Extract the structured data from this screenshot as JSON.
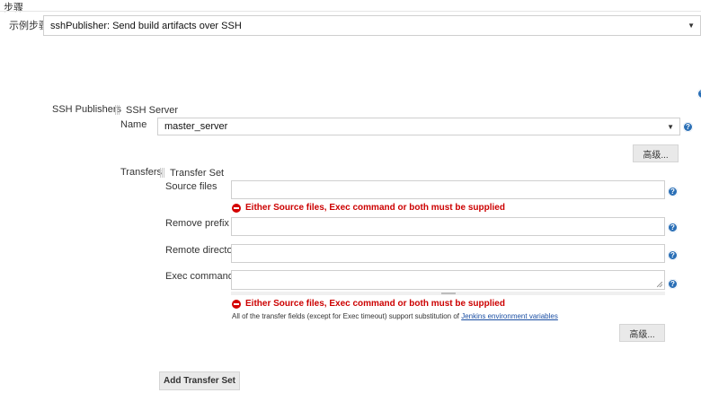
{
  "section": {
    "title": "步骤"
  },
  "step": {
    "label": "示例步骤",
    "value": "sshPublisher: Send build artifacts over SSH"
  },
  "ssh": {
    "publishers_label": "SSH Publishers",
    "server_label": "SSH Server",
    "name_label": "Name",
    "name_value": "master_server",
    "advanced_label": "高级..."
  },
  "transfers": {
    "label": "Transfers",
    "set_label": "Transfer Set",
    "source_files_label": "Source files",
    "source_files_value": "",
    "remove_prefix_label": "Remove prefix",
    "remove_prefix_value": "",
    "remote_directory_label": "Remote directory",
    "remote_directory_value": "",
    "exec_command_label": "Exec command",
    "exec_command_value": "",
    "error_message": "Either Source files, Exec command or both must be supplied",
    "note_text": "All of the transfer fields (except for Exec timeout) support substitution of ",
    "note_link": "Jenkins environment variables",
    "advanced_label": "高级...",
    "add_button_label": "Add Transfer Set"
  },
  "icons": {
    "help": "help-icon",
    "error": "error-icon",
    "dropdown": "chevron-down-icon",
    "drag": "drag-handle-icon"
  }
}
